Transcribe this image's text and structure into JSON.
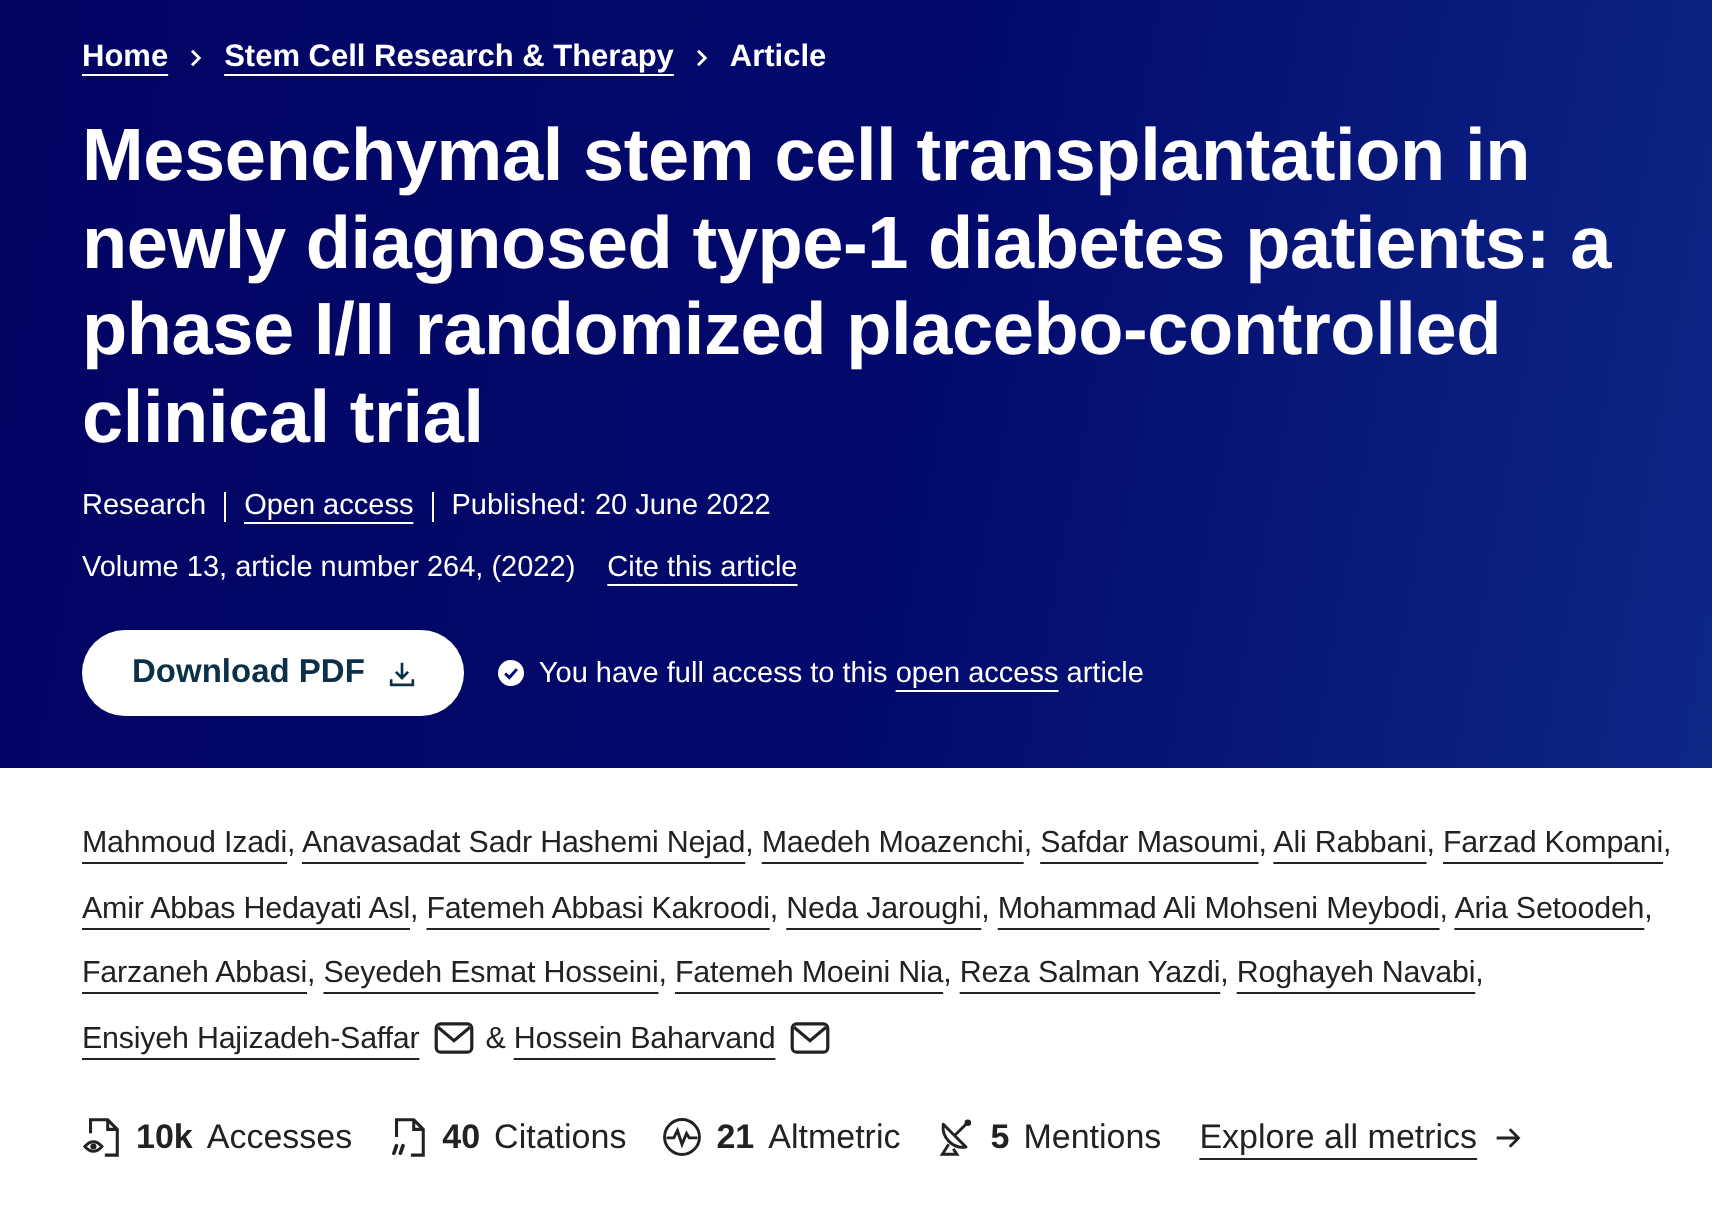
{
  "breadcrumbs": [
    {
      "label": "Home",
      "current": false
    },
    {
      "label": "Stem Cell Research & Therapy",
      "current": false
    },
    {
      "label": "Article",
      "current": true
    }
  ],
  "title": "Mesenchymal stem cell transplantation in newly diagnosed type-1 diabetes patients: a phase I/II randomized placebo-controlled clinical trial",
  "meta": {
    "article_type": "Research",
    "access_link": "Open access",
    "published": "Published: 20 June 2022",
    "citation": "Volume 13, article number 264, (2022)",
    "cite_link": "Cite this article"
  },
  "download_button": {
    "label": "Download PDF"
  },
  "access_note": {
    "text_before": "You have full access to this",
    "link": "open access",
    "text_after": "article"
  },
  "authors": [
    {
      "name": "Mahmoud Izadi",
      "separator": ",",
      "corresponding": false
    },
    {
      "name": "Anavasadat Sadr Hashemi Nejad",
      "separator": ",",
      "corresponding": false
    },
    {
      "name": "Maedeh Moazenchi",
      "separator": ",",
      "corresponding": false
    },
    {
      "name": "Safdar Masoumi",
      "separator": ",",
      "corresponding": false
    },
    {
      "name": "Ali Rabbani",
      "separator": ",",
      "corresponding": false
    },
    {
      "name": "Farzad Kompani",
      "separator": ",",
      "corresponding": false
    },
    {
      "name": "Amir Abbas Hedayati Asl",
      "separator": ",",
      "corresponding": false
    },
    {
      "name": "Fatemeh Abbasi Kakroodi",
      "separator": ",",
      "corresponding": false
    },
    {
      "name": "Neda Jaroughi",
      "separator": ",",
      "corresponding": false
    },
    {
      "name": "Mohammad Ali Mohseni Meybodi",
      "separator": ",",
      "corresponding": false
    },
    {
      "name": "Aria Setoodeh",
      "separator": ",",
      "corresponding": false
    },
    {
      "name": "Farzaneh Abbasi",
      "separator": ",",
      "corresponding": false
    },
    {
      "name": "Seyedeh Esmat Hosseini",
      "separator": ",",
      "corresponding": false
    },
    {
      "name": "Fatemeh Moeini Nia",
      "separator": ",",
      "corresponding": false
    },
    {
      "name": "Reza Salman Yazdi",
      "separator": ",",
      "corresponding": false
    },
    {
      "name": "Roghayeh Navabi",
      "separator": ",",
      "corresponding": false
    },
    {
      "name": "Ensiyeh Hajizadeh-Saffar",
      "separator": "&",
      "corresponding": true
    },
    {
      "name": "Hossein Baharvand",
      "corresponding": true
    }
  ],
  "metrics": [
    {
      "kind": "accesses",
      "value": "10k",
      "label": "Accesses"
    },
    {
      "kind": "citations",
      "value": "40",
      "label": "Citations"
    },
    {
      "kind": "altmetric",
      "value": "21",
      "label": "Altmetric"
    },
    {
      "kind": "mentions",
      "value": "5",
      "label": "Mentions"
    }
  ],
  "explore_link": "Explore all metrics"
}
